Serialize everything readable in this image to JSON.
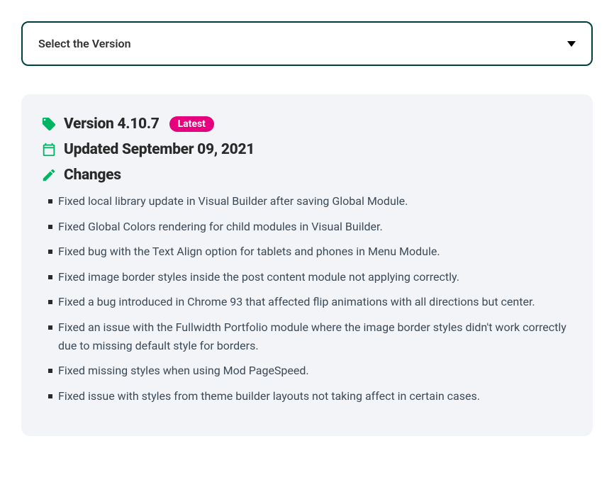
{
  "select": {
    "label": "Select the Version"
  },
  "version": {
    "title_prefix": "Version",
    "number": "4.10.7",
    "badge": "Latest"
  },
  "updated": {
    "prefix": "Updated",
    "date": "September 09, 2021"
  },
  "changes": {
    "heading": "Changes",
    "items": [
      "Fixed local library update in Visual Builder after saving Global Module.",
      "Fixed Global Colors rendering for child modules in Visual Builder.",
      "Fixed bug with the Text Align option for tablets and phones in Menu Module.",
      "Fixed image border styles inside the post content module not applying correctly.",
      "Fixed a bug introduced in Chrome 93 that affected flip animations with all directions but center.",
      "Fixed an issue with the Fullwidth Portfolio module where the image border styles didn't work correctly due to missing default style for borders.",
      "Fixed missing styles when using Mod PageSpeed.",
      "Fixed issue with styles from theme builder layouts not taking affect in certain cases."
    ]
  },
  "colors": {
    "accent_green": "#00b562",
    "badge_pink": "#e6007e",
    "border_dark": "#004040"
  }
}
